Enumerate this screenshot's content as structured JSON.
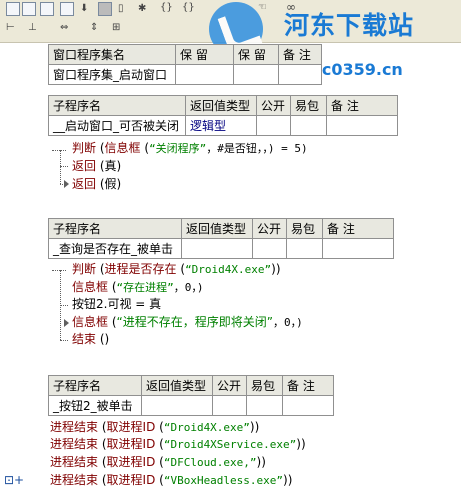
{
  "watermark": {
    "title": "河东下载站",
    "url": "www.pc0359.cn"
  },
  "toolbar_icons": [
    "grid-icon",
    "grid-icon",
    "grid-icon",
    "grid-icon",
    "down-arrow-icon",
    "stop-icon",
    "bug-icon",
    "braces-icon",
    "braces-icon",
    "braces-icon",
    "hand-icon",
    "binoculars-icon",
    "align-icon",
    "align-icon",
    "resize-icon",
    "resize-icon",
    "resize-icon"
  ],
  "set_table": {
    "headers": [
      "窗口程序集名",
      "保 留",
      "保 留",
      "备 注"
    ],
    "row": [
      "窗口程序集_启动窗口",
      "",
      "",
      ""
    ]
  },
  "sub1": {
    "headers": [
      "子程序名",
      "返回值类型",
      "公开",
      "易包",
      "备 注"
    ],
    "row": [
      "__启动窗口_可否被关闭",
      "逻辑型",
      "",
      "",
      ""
    ],
    "lines": [
      {
        "k": "判断",
        "a": "(",
        "f": "信息框",
        "b": "(",
        "s": "“关闭程序”",
        "r": "，#是否钮，，) = 5)"
      },
      {
        "k": "返回",
        "r": "(真)"
      },
      {
        "k": "返回",
        "r": "(假)"
      }
    ]
  },
  "sub2": {
    "headers": [
      "子程序名",
      "返回值类型",
      "公开",
      "易包",
      "备 注"
    ],
    "row": [
      "_查询是否存在_被单击",
      "",
      "",
      "",
      ""
    ],
    "lines": [
      {
        "k": "判断",
        "r1": "(",
        "f": "进程是否存在",
        "r2": "(",
        "s": "“Droid4X.exe”",
        "r3": "))"
      },
      {
        "f": "信息框",
        "r1": "(",
        "s": "“存在进程”",
        "r2": "，0，)"
      },
      {
        "p": "按钮2.可视 = 真"
      },
      {
        "f": "信息框",
        "r1": "(",
        "s": "“进程不存在，程序即将关闭”",
        "r2": "，0，)"
      },
      {
        "k": "结束",
        "r": "()"
      }
    ]
  },
  "sub3": {
    "headers": [
      "子程序名",
      "返回值类型",
      "公开",
      "易包",
      "备 注"
    ],
    "row": [
      "_按钮2_被单击",
      "",
      "",
      "",
      ""
    ],
    "lines": [
      {
        "f": "进程结束",
        "a": "(",
        "g": "取进程ID",
        "b": "(",
        "s": "“Droid4X.exe”",
        "r": "))"
      },
      {
        "f": "进程结束",
        "a": "(",
        "g": "取进程ID",
        "b": "(",
        "s": "“Droid4XService.exe”",
        "r": "))"
      },
      {
        "f": "进程结束",
        "a": "(",
        "g": "取进程ID",
        "b": "(",
        "s": "“DFCloud.exe,”",
        "r": "))"
      },
      {
        "f": "进程结束",
        "a": "(",
        "g": "取进程ID",
        "b": "(",
        "s": "“VBoxHeadless.exe”",
        "r": "))"
      }
    ]
  }
}
